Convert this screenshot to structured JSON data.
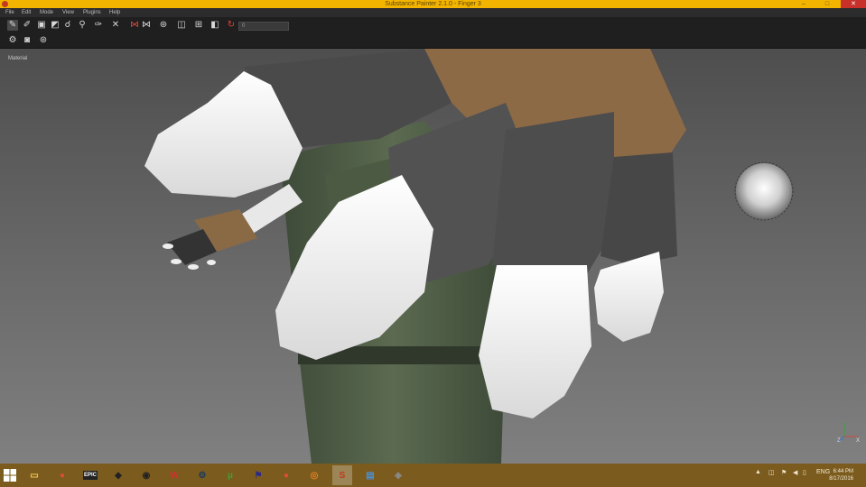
{
  "window": {
    "title": "Substance Painter 2.1.0 - Finger 3",
    "minimize": "–",
    "maximize": "□",
    "close": "✕"
  },
  "menu": {
    "items": [
      "File",
      "Edit",
      "Mode",
      "View",
      "Plugins",
      "Help"
    ]
  },
  "toolbar": {
    "tools": [
      {
        "name": "paint-tool-icon",
        "glyph": "✎"
      },
      {
        "name": "eraser-tool-icon",
        "glyph": "✐"
      },
      {
        "name": "projection-tool-icon",
        "glyph": "▣"
      },
      {
        "name": "geometry-mask-icon",
        "glyph": "◩"
      },
      {
        "name": "smudge-tool-icon",
        "glyph": "☌"
      },
      {
        "name": "clone-tool-icon",
        "glyph": "⚲"
      },
      {
        "name": "color-picker-icon",
        "glyph": "✑"
      },
      {
        "name": "symmetry-icon",
        "glyph": "⋈"
      },
      {
        "name": "lazy-mouse-icon",
        "glyph": "⊛"
      },
      {
        "name": "camera-icon",
        "glyph": "◫"
      },
      {
        "name": "alignment-icon",
        "glyph": "⊞"
      },
      {
        "name": "redo-icon",
        "glyph": "↻"
      }
    ],
    "slider_value": "0"
  },
  "viewport": {
    "label": "Material"
  },
  "taskbar": {
    "apps": [
      {
        "name": "file-explorer-icon",
        "glyph": "▭",
        "color": "#f2c94c"
      },
      {
        "name": "chrome-icon",
        "glyph": "●",
        "color": "#e14b3b"
      },
      {
        "name": "epic-games-icon",
        "glyph": "EPIC",
        "color": "#222222"
      },
      {
        "name": "unity-icon",
        "glyph": "◆",
        "color": "#222222"
      },
      {
        "name": "obs-icon",
        "glyph": "◉",
        "color": "#222222"
      },
      {
        "name": "wacom-icon",
        "glyph": "W",
        "color": "#d62e2e"
      },
      {
        "name": "steam-icon",
        "glyph": "⚙",
        "color": "#1b3a5c"
      },
      {
        "name": "utorrent-icon",
        "glyph": "µ",
        "color": "#3aa13a"
      },
      {
        "name": "flag-app-icon",
        "glyph": "⚑",
        "color": "#2a2a8a"
      },
      {
        "name": "chrome-alt-icon",
        "glyph": "●",
        "color": "#e14b3b"
      },
      {
        "name": "blender-icon",
        "glyph": "◎",
        "color": "#e5801e"
      },
      {
        "name": "substance-painter-icon",
        "glyph": "S",
        "color": "#c23a1f"
      },
      {
        "name": "photos-icon",
        "glyph": "▤",
        "color": "#4a90d9"
      },
      {
        "name": "misc-app-icon",
        "glyph": "◈",
        "color": "#8a8a8a"
      }
    ],
    "tray_lang": "ENG",
    "clock_time": "6:44 PM",
    "clock_date": "8/17/2016"
  },
  "colors": {
    "title_bar": "#f3b400",
    "taskbar": "#7b5c1e",
    "viewport_top": "#4e4e4e",
    "viewport_bottom": "#808080",
    "close_button": "#c7312a"
  }
}
